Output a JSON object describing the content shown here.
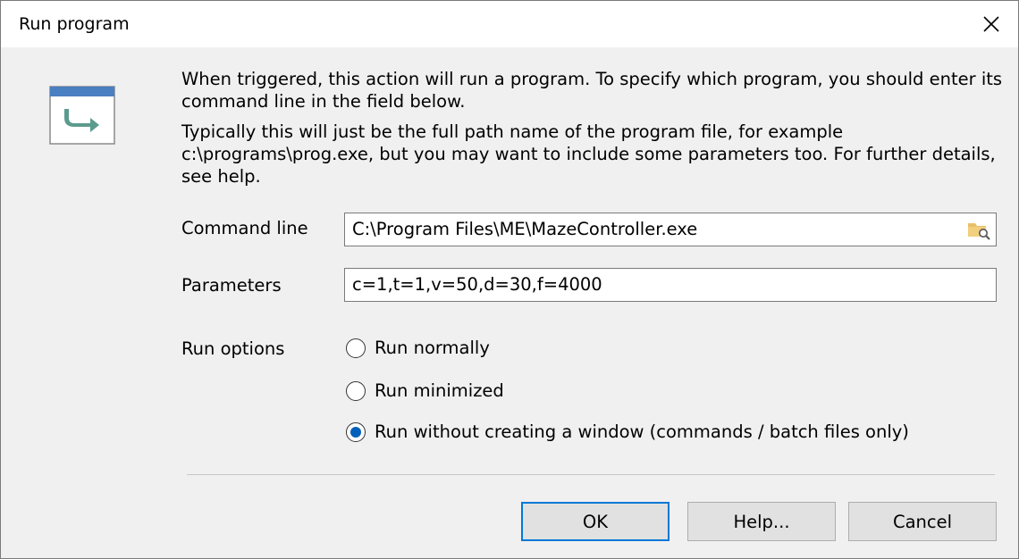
{
  "window": {
    "title": "Run program"
  },
  "description": {
    "paragraph1": "When triggered, this action will run a program. To specify which program, you should enter its command line in the field below.",
    "paragraph2": "Typically this will just be the full path name of the program file, for example c:\\programs\\prog.exe, but you may want to include some parameters too. For further details, see help."
  },
  "form": {
    "command_line_label": "Command line",
    "command_line_value": "C:\\Program Files\\ME\\MazeController.exe",
    "parameters_label": "Parameters",
    "parameters_value": "c=1,t=1,v=50,d=30,f=4000",
    "run_options_label": "Run options",
    "run_options": [
      {
        "label": "Run normally",
        "selected": false
      },
      {
        "label": "Run minimized",
        "selected": false
      },
      {
        "label": "Run without creating a window (commands / batch files only)",
        "selected": true
      }
    ]
  },
  "buttons": {
    "ok": "OK",
    "help": "Help...",
    "cancel": "Cancel"
  },
  "icons": {
    "close": "close-icon",
    "app": "run-program-icon",
    "browse": "folder-search-icon"
  },
  "colors": {
    "accent": "#0078d7",
    "radio_selected": "#005fb8",
    "icon_bar": "#4a7fc1",
    "icon_arrow": "#5a9b8e",
    "folder": "#e8c06a"
  }
}
